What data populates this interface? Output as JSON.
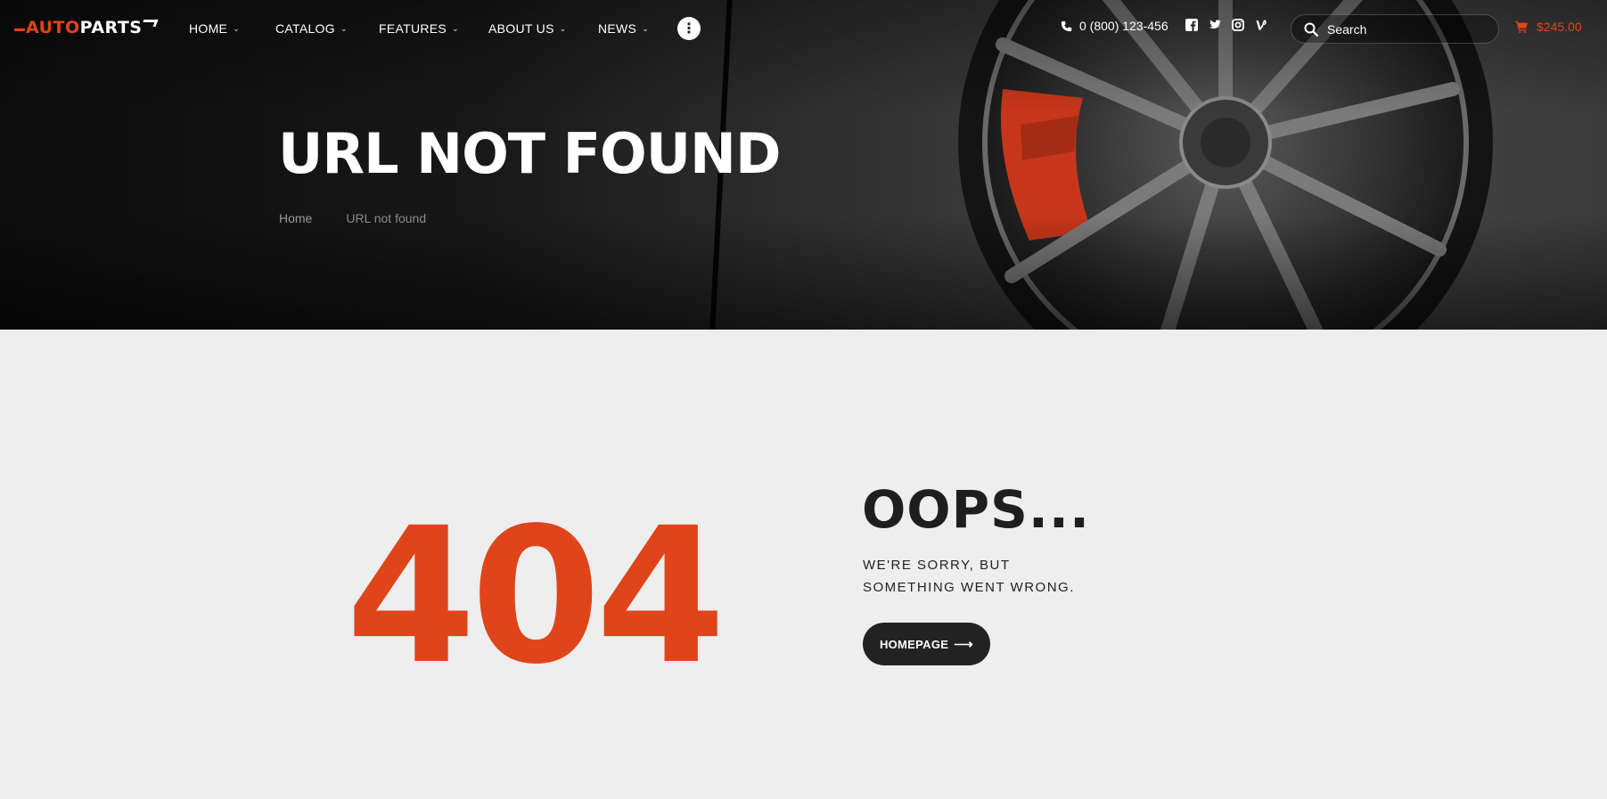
{
  "header": {
    "logo": {
      "part1": "AUTO",
      "part2": "PARTS"
    },
    "nav": [
      {
        "label": "HOME"
      },
      {
        "label": "CATALOG"
      },
      {
        "label": "FEATURES"
      },
      {
        "label": "ABOUT US"
      },
      {
        "label": "NEWS"
      }
    ],
    "more_icon": "more-vertical-icon",
    "phone": "0 (800) 123-456",
    "socials": [
      "facebook-icon",
      "twitter-icon",
      "instagram-icon",
      "vine-icon"
    ],
    "search": {
      "placeholder": "Search",
      "value": ""
    },
    "cart": {
      "total": "$245.00"
    }
  },
  "hero": {
    "title": "URL NOT FOUND",
    "breadcrumb": {
      "home": "Home",
      "current": "URL not found"
    }
  },
  "error": {
    "code": "404",
    "heading": "OOPS...",
    "message_line1": "WE'RE SORRY, BUT",
    "message_line2": "SOMETHING WENT WRONG.",
    "button_label": "HOMEPAGE"
  },
  "colors": {
    "accent": "#e0441a",
    "dark": "#222222",
    "background": "#eeeeee"
  }
}
